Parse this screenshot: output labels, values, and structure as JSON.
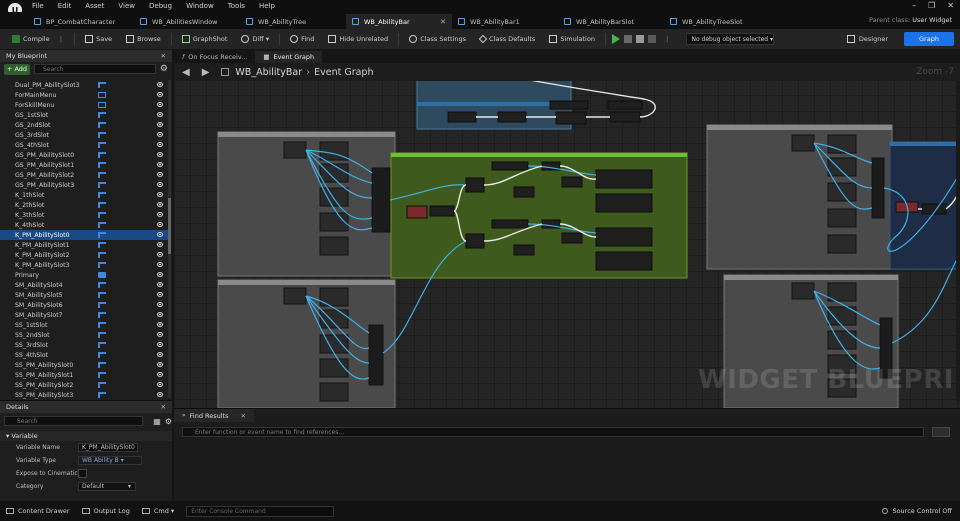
{
  "menu": [
    "File",
    "Edit",
    "Asset",
    "View",
    "Debug",
    "Window",
    "Tools",
    "Help"
  ],
  "window_controls": [
    "–",
    "❐",
    "✕"
  ],
  "doc_tabs": [
    {
      "label": "BP_CombatCharacter",
      "active": false
    },
    {
      "label": "WB_AbilitiesWindow",
      "active": false
    },
    {
      "label": "WB_AbilityTree",
      "active": false
    },
    {
      "label": "WB_AbilityBar",
      "active": true
    },
    {
      "label": "WB_AbilityBar1",
      "active": false
    },
    {
      "label": "WB_AbilityBarSlot",
      "active": false
    },
    {
      "label": "WB_AbilityTreeSlot",
      "active": false
    }
  ],
  "parent_class": {
    "label": "Parent class:",
    "value": "User Widget"
  },
  "toolbar": {
    "compile": "Compile",
    "save": "Save",
    "browse": "Browse",
    "graphshot": "GraphShot",
    "diff": "Diff",
    "find": "Find",
    "hide_unrelated": "Hide Unrelated",
    "class_settings": "Class Settings",
    "class_defaults": "Class Defaults",
    "simulation": "Simulation",
    "debug_object": "No debug object selected",
    "designer": "Designer",
    "graph": "Graph"
  },
  "my_blueprint": {
    "title": "My Blueprint",
    "add_label": "+ Add",
    "search_placeholder": "Search",
    "variables": [
      {
        "name": "Dual_PM_AbilitySlot3",
        "type": "arr"
      },
      {
        "name": "ForMainMenu",
        "type": "box"
      },
      {
        "name": "ForSkillMenu",
        "type": "box"
      },
      {
        "name": "GS_1stSlot",
        "type": "arr"
      },
      {
        "name": "GS_2ndSlot",
        "type": "arr"
      },
      {
        "name": "GS_3rdSlot",
        "type": "arr"
      },
      {
        "name": "GS_4thSlot",
        "type": "arr"
      },
      {
        "name": "GS_PM_AbilitySlot0",
        "type": "arr"
      },
      {
        "name": "GS_PM_AbilitySlot1",
        "type": "arr"
      },
      {
        "name": "GS_PM_AbilitySlot2",
        "type": "arr"
      },
      {
        "name": "GS_PM_AbilitySlot3",
        "type": "arr"
      },
      {
        "name": "K_1thSlot",
        "type": "arr"
      },
      {
        "name": "K_2thSlot",
        "type": "arr"
      },
      {
        "name": "K_3thSlot",
        "type": "arr"
      },
      {
        "name": "K_4thSlot",
        "type": "arr"
      },
      {
        "name": "K_PM_AbilitySlot0",
        "type": "arr",
        "selected": true
      },
      {
        "name": "K_PM_AbilitySlot1",
        "type": "arr"
      },
      {
        "name": "K_PM_AbilitySlot2",
        "type": "arr"
      },
      {
        "name": "K_PM_AbilitySlot3",
        "type": "arr"
      },
      {
        "name": "Primary",
        "type": "struct"
      },
      {
        "name": "SM_AbilitySlot4",
        "type": "arr"
      },
      {
        "name": "SM_AbilitySlot5",
        "type": "arr"
      },
      {
        "name": "SM_AbilitySlot6",
        "type": "arr"
      },
      {
        "name": "SM_AbilitySlot7",
        "type": "arr"
      },
      {
        "name": "SS_1stSlot",
        "type": "arr"
      },
      {
        "name": "SS_2ndSlot",
        "type": "arr"
      },
      {
        "name": "SS_3rdSlot",
        "type": "arr"
      },
      {
        "name": "SS_4thSlot",
        "type": "arr"
      },
      {
        "name": "SS_PM_AbilitySlot0",
        "type": "arr"
      },
      {
        "name": "SS_PM_AbilitySlot1",
        "type": "arr"
      },
      {
        "name": "SS_PM_AbilitySlot2",
        "type": "arr"
      },
      {
        "name": "SS_PM_AbilitySlot3",
        "type": "arr"
      }
    ]
  },
  "details": {
    "title": "Details",
    "search_placeholder": "Search",
    "section": "Variable",
    "variable_name_label": "Variable Name",
    "variable_name": "K_PM_AbilitySlot0",
    "variable_type_label": "Variable Type",
    "variable_type": "WB Ability B",
    "expose_label": "Expose to Cinematics",
    "category_label": "Category",
    "category": "Default"
  },
  "graph": {
    "tabs": [
      "On Focus Receiv...",
      "Event Graph"
    ],
    "active_tab": 1,
    "blueprint_name": "WB_AbilityBar",
    "crumb": "Event Graph",
    "zoom": "Zoom -7",
    "watermark": "WIDGET BLUEPRINT"
  },
  "find_results": {
    "title": "Find Results",
    "placeholder": "Enter function or event name to find references..."
  },
  "status": {
    "content_drawer": "Content Drawer",
    "output_log": "Output Log",
    "cmd": "Cmd",
    "console_placeholder": "Enter Console Command",
    "source_control": "Source Control Off"
  },
  "colors": {
    "accent": "#1a73e8",
    "wire": "#3fb0e8",
    "comment_green": "#4a6a1e",
    "selection": "#1a4a86"
  }
}
